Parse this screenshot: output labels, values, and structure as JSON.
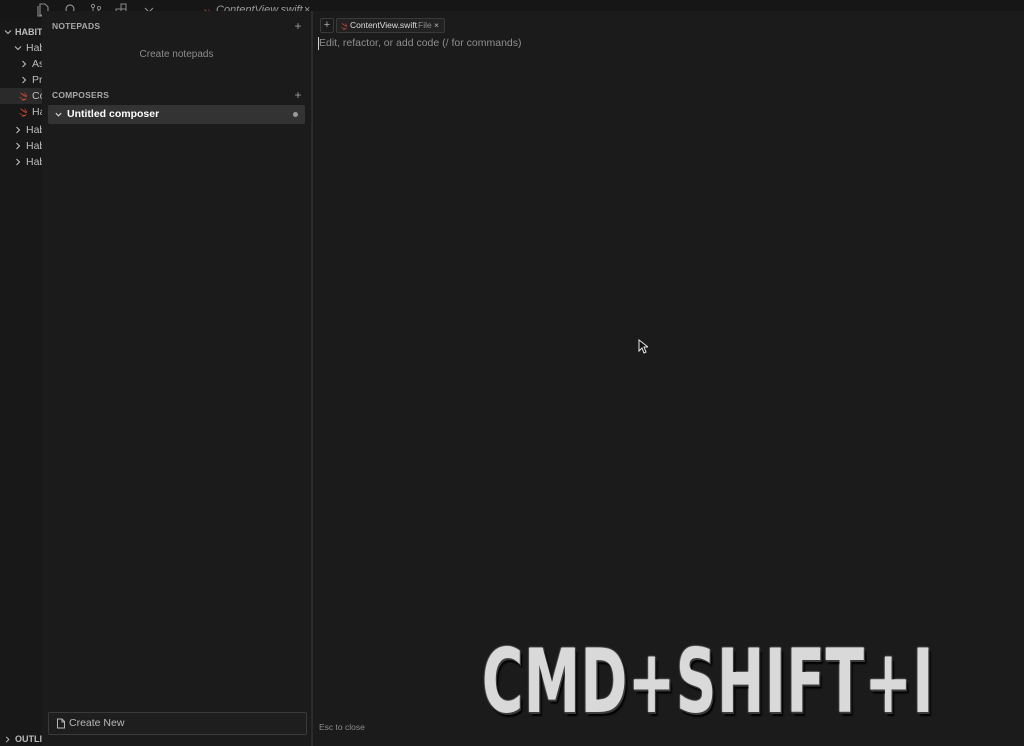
{
  "background_ide": {
    "editor_tab_label": "ContentView.swift",
    "editor_tab_close": "×",
    "explorer": {
      "root_label": "HABIT",
      "rows": [
        "Hab",
        "As",
        "Pr",
        "Co",
        "Ha",
        "Hab",
        "Hab",
        "Hab"
      ]
    },
    "outline_label": "OUTLINE"
  },
  "composer_panel": {
    "notepads": {
      "title": "NOTEPADS",
      "add_label": "+",
      "empty_text": "Create notepads"
    },
    "composers": {
      "title": "COMPOSERS",
      "add_label": "+",
      "items": [
        {
          "label": "Untitled composer"
        }
      ]
    },
    "create_new_label": "Create New"
  },
  "editor": {
    "add_context_label": "+",
    "context_chip": {
      "name": "ContentView.swift",
      "kind": "File",
      "close": "×"
    },
    "placeholder": "Edit, refactor, or add code (/ for commands)",
    "esc_hint": "Esc to close"
  },
  "caption": {
    "shortcut": "CMD+SHIFT+I"
  },
  "colors": {
    "background": "#141414",
    "panel": "#1b1b1b",
    "selected_item": "#333333",
    "swift_orange": "#f05138",
    "accent_blue": "#3b7dd8"
  }
}
